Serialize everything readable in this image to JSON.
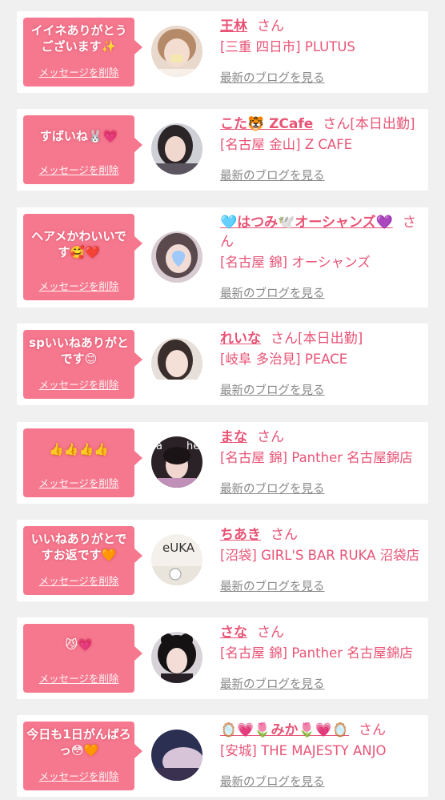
{
  "common": {
    "delete_label": "メッセージを削除",
    "blog_label": "最新のブログを見る",
    "san": "さん"
  },
  "colors": {
    "bubble": "#f6788e",
    "accent": "#e85476",
    "page_bg": "#f0f0f0"
  },
  "items": [
    {
      "message": "イイネありがとうございます✨",
      "name": "王林",
      "status": "",
      "shop": "[三重 四日市] PLUTUS"
    },
    {
      "message": "すばいね🐰💗",
      "name": "こた🐯 ZCafe",
      "status": "[本日出勤]",
      "shop": "[名古屋 金山] Z CAFE"
    },
    {
      "message": "ヘアメかわいいです🥰❤️",
      "name": "🩵はつみ🕊️オーシャンズ💜",
      "status": "",
      "shop": "[名古屋 錦] オーシャンズ"
    },
    {
      "message": "spいいねありがとです😊",
      "name": "れいな",
      "status": "[本日出勤]",
      "shop": "[岐阜 多治見] PEACE"
    },
    {
      "message": "👍👍👍👍",
      "name": "まな",
      "status": "",
      "shop": "[名古屋 錦] Panther 名古屋錦店"
    },
    {
      "message": "いいねありがとですお返です🧡",
      "name": "ちあき",
      "status": "",
      "shop": "[沼袋] GIRL'S BAR RUKA 沼袋店"
    },
    {
      "message": "😼💗",
      "name": "さな",
      "status": "",
      "shop": "[名古屋 錦] Panther 名古屋錦店"
    },
    {
      "message": "今日も1日がんばろっ😳🧡",
      "name": "🪞💗🌷みか🌷💗🪞",
      "status": "",
      "shop": "[安城] THE MAJESTY ANJO"
    }
  ]
}
